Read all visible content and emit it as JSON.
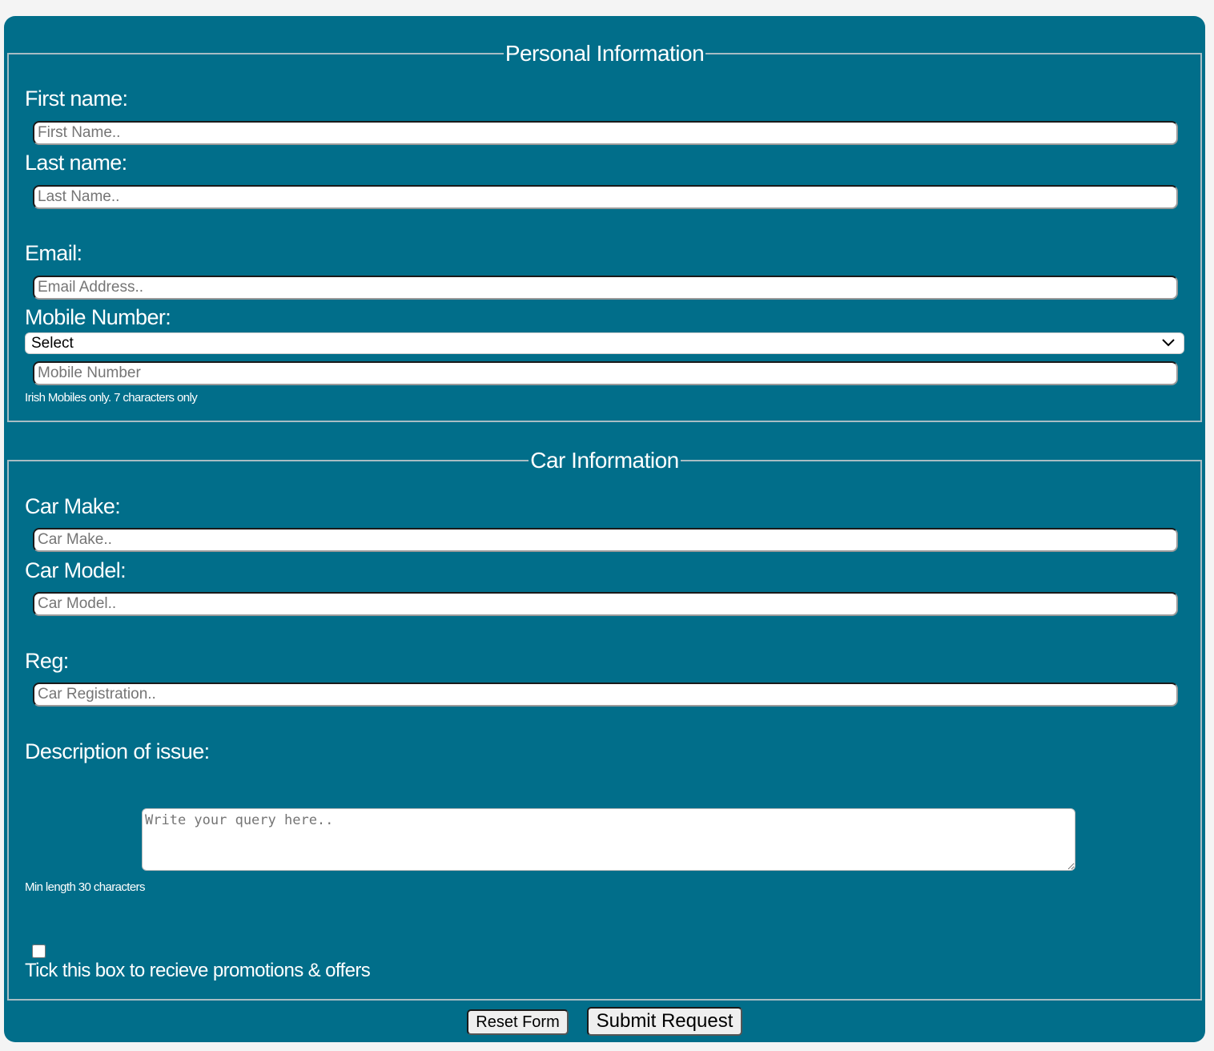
{
  "personal": {
    "legend": "Personal Information",
    "first_name_label": "First name:",
    "first_name_placeholder": "First Name..",
    "last_name_label": "Last name:",
    "last_name_placeholder": "Last Name..",
    "email_label": "Email:",
    "email_placeholder": "Email Address..",
    "mobile_label": "Mobile Number:",
    "mobile_select_value": "Select",
    "mobile_placeholder": "Mobile Number",
    "mobile_hint": "Irish Mobiles only. 7 characters only"
  },
  "car": {
    "legend": "Car Information",
    "make_label": "Car Make:",
    "make_placeholder": "Car Make..",
    "model_label": "Car Model:",
    "model_placeholder": "Car Model..",
    "reg_label": "Reg:",
    "reg_placeholder": "Car Registration..",
    "description_label": "Description of issue:",
    "description_placeholder": "Write your query here..",
    "description_hint": "Min length 30 characters",
    "promo_checked": false,
    "promo_label": "Tick this box to recieve promotions & offers"
  },
  "actions": {
    "reset_label": "Reset Form",
    "submit_label": "Submit Request"
  },
  "colors": {
    "form_background": "#016e8a",
    "page_background": "#f4f4f4",
    "text": "#ffffff"
  }
}
